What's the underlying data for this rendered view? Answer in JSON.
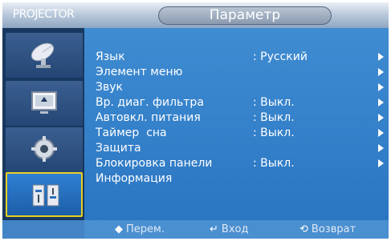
{
  "brand": "PROJECTOR",
  "title": "Параметр",
  "sidebar": {
    "items": [
      {
        "icon": "satellite-dish-icon"
      },
      {
        "icon": "picture-screen-icon"
      },
      {
        "icon": "settings-gear-icon"
      },
      {
        "icon": "setup-options-icon",
        "active": true
      }
    ]
  },
  "menu": {
    "rows": [
      {
        "label": "Язык",
        "value": ": Русский",
        "arrow": true
      },
      {
        "label": "Элемент меню",
        "value": "",
        "arrow": true
      },
      {
        "label": "Звук",
        "value": "",
        "arrow": true
      },
      {
        "label": "Вр. диаг. фильтра",
        "value": ": Выкл.",
        "arrow": true
      },
      {
        "label": "Автовкл. питания",
        "value": ": Выкл.",
        "arrow": true
      },
      {
        "label": "Таймер  сна",
        "value": ": Выкл.",
        "arrow": true
      },
      {
        "label": "Защита",
        "value": "",
        "arrow": true
      },
      {
        "label": "Блокировка панели",
        "value": ": Выкл.",
        "arrow": true
      },
      {
        "label": "Информация",
        "value": "",
        "arrow": false
      }
    ]
  },
  "footer": {
    "move": {
      "icon": "up-down-arrows-icon",
      "label": "Перем."
    },
    "enter": {
      "icon": "enter-icon",
      "label": "Вход"
    },
    "return": {
      "icon": "return-icon",
      "label": "Возврат"
    }
  },
  "colors": {
    "accent": "#2b76c2",
    "active_border": "#e8d024",
    "sidebar": "#18385f"
  }
}
